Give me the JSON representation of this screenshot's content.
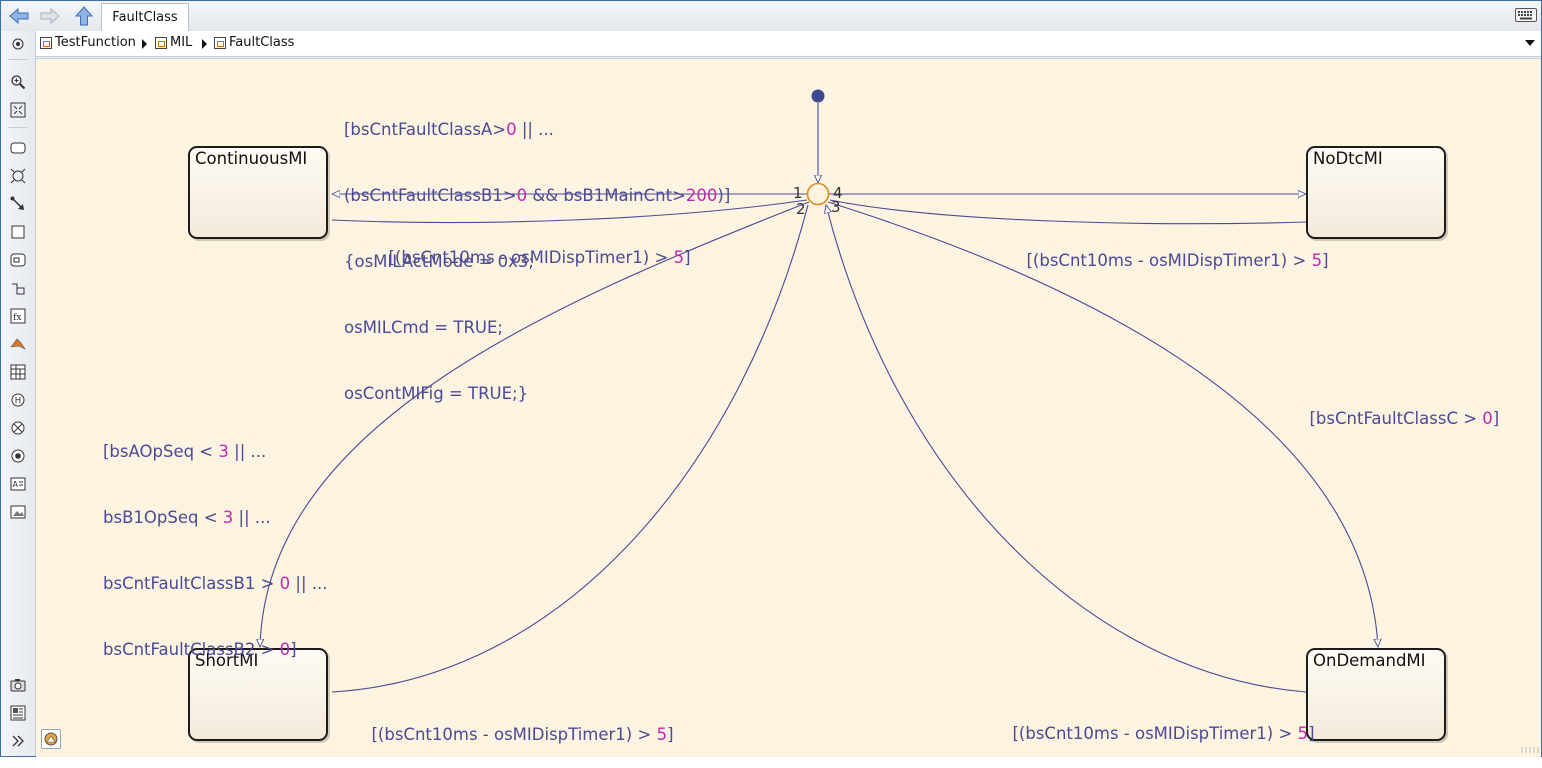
{
  "tab": {
    "title": "FaultClass"
  },
  "breadcrumb": {
    "items": [
      {
        "label": "TestFunction"
      },
      {
        "label": "MIL"
      },
      {
        "label": "FaultClass"
      }
    ]
  },
  "palette": {
    "tools": [
      "hide-show-icon",
      "zoom-icon",
      "fit-view-icon",
      "state-icon",
      "junction-icon",
      "transition-icon",
      "box-icon",
      "subchart-icon",
      "simulink-function-icon",
      "matlab-function-icon",
      "truth-table-icon",
      "graphical-function-icon",
      "history-junction-icon",
      "exit-junction-icon",
      "entry-junction-icon",
      "annotation-icon",
      "image-icon",
      "snapshot-icon",
      "explorer-icon",
      "more-icon"
    ]
  },
  "states": {
    "continuous": "ContinuousMI",
    "nodtc": "NoDtcMI",
    "short": "ShortMI",
    "ondemand": "OnDemandMI"
  },
  "transition_orders": {
    "t1": "1",
    "t2": "2",
    "t3": "3",
    "t4": "4"
  },
  "labels": {
    "continuous_guard": {
      "l1a": "[bsCntFaultClassA>",
      "l1n": "0",
      "l1b": " || ...",
      "l2a": "(bsCntFaultClassB1>",
      "l2n": "0",
      "l2b": " && bsB1MainCnt>",
      "l2n2": "200",
      "l2c": ")]",
      "l3": "{osMILActMode = 0x3;",
      "l4": "osMILCmd = TRUE;",
      "l5": "osContMIFig = TRUE;}"
    },
    "short_guard": {
      "l1a": "[bsAOpSeq < ",
      "l1n": "3",
      "l1b": " || ...",
      "l2a": "bsB1OpSeq < ",
      "l2n": "3",
      "l2b": " || ...",
      "l3a": "bsCntFaultClassB1 > ",
      "l3n": "0",
      "l3b": " || ...",
      "l4a": "bsCntFaultClassB2 > ",
      "l4n": "0",
      "l4b": "]"
    },
    "ondemand_guard": {
      "a": "[bsCntFaultClassC > ",
      "n": "0",
      "b": "]"
    },
    "timer_continuous": {
      "a": "[(bsCnt10ms - osMIDispTimer1) > ",
      "n": "5",
      "b": "]"
    },
    "timer_nodtc": {
      "a": "[(bsCnt10ms - osMIDispTimer1) > ",
      "n": "5",
      "b": "]"
    },
    "timer_short": {
      "a": "[(bsCnt10ms - osMIDispTimer1) > ",
      "n": "5",
      "b": "]"
    },
    "timer_ondemand": {
      "a": "[(bsCnt10ms - osMIDispTimer1) > ",
      "n": "5",
      "b": "]"
    }
  },
  "colors": {
    "canvas": "#fdf3e1",
    "transition": "#4a4a96",
    "number": "#c028b2",
    "junction": "#e08a1e",
    "default_dot": "#3d4890"
  }
}
